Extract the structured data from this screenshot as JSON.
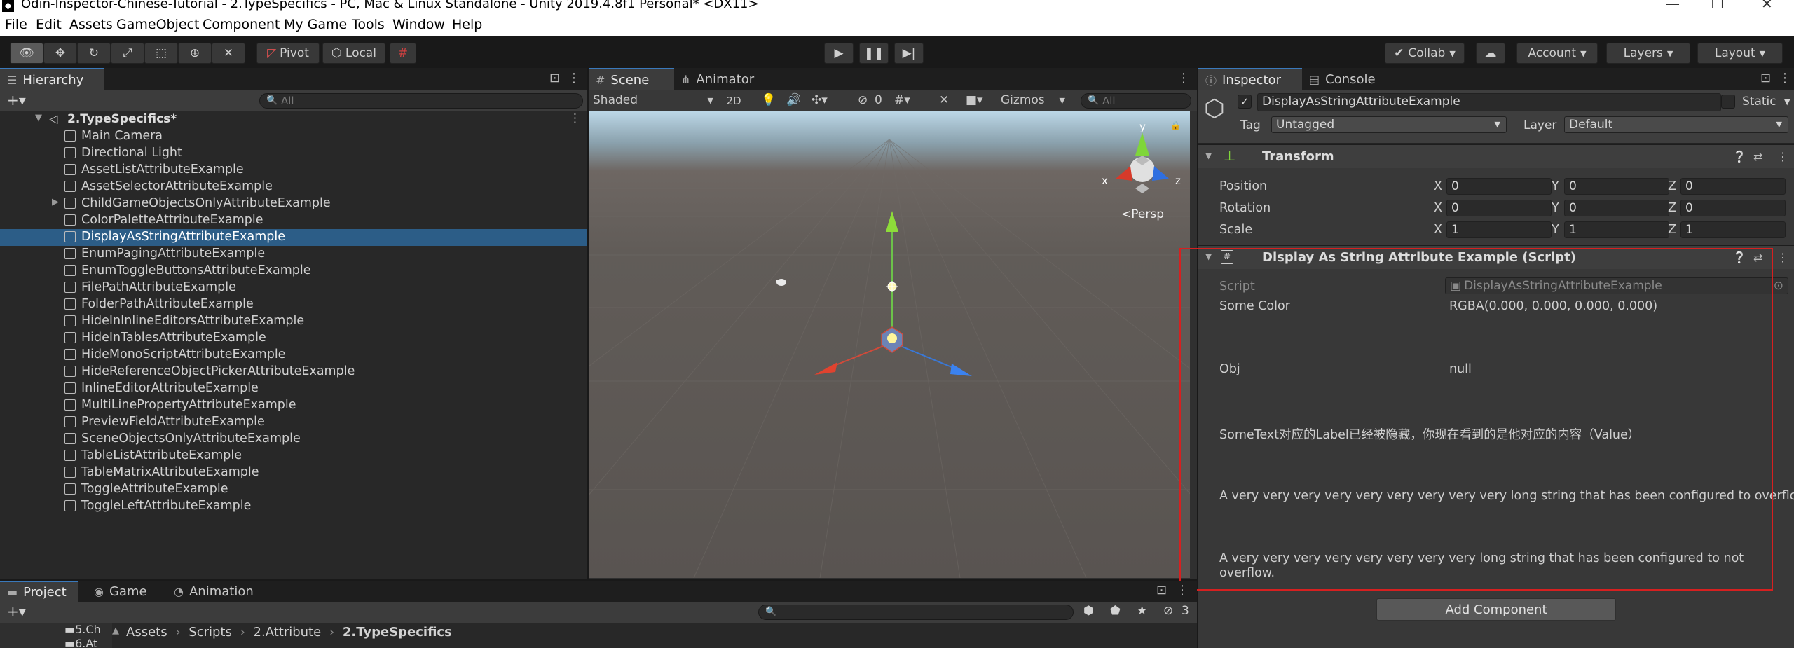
{
  "window": {
    "title": "Odin-Inspector-Chinese-Tutorial - 2.TypeSpecifics - PC, Mac & Linux Standalone - Unity 2019.4.8f1 Personal* <DX11>",
    "app_icon": "unity-icon"
  },
  "menu": [
    "File",
    "Edit",
    "Assets",
    "GameObject",
    "Component",
    "My Game",
    "Tools",
    "Window",
    "Help"
  ],
  "toolbar": {
    "pivot": "Pivot",
    "local": "Local",
    "collab": "Collab",
    "account": "Account",
    "layers": "Layers",
    "layout": "Layout"
  },
  "hierarchy": {
    "tab": "Hierarchy",
    "search_placeholder": "All",
    "scene": "2.TypeSpecifics*",
    "items": [
      "Main Camera",
      "Directional Light",
      "AssetListAttributeExample",
      "AssetSelectorAttributeExample",
      "ChildGameObjectsOnlyAttributeExample",
      "ColorPaletteAttributeExample",
      "DisplayAsStringAttributeExample",
      "EnumPagingAttributeExample",
      "EnumToggleButtonsAttributeExample",
      "FilePathAttributeExample",
      "FolderPathAttributeExample",
      "HideInInlineEditorsAttributeExample",
      "HideInTablesAttributeExample",
      "HideMonoScriptAttributeExample",
      "HideReferenceObjectPickerAttributeExample",
      "InlineEditorAttributeExample",
      "MultiLinePropertyAttributeExample",
      "PreviewFieldAttributeExample",
      "SceneObjectsOnlyAttributeExample",
      "TableListAttributeExample",
      "TableMatrixAttributeExample",
      "ToggleAttributeExample",
      "ToggleLeftAttributeExample"
    ],
    "selected_index": 6
  },
  "scene": {
    "tabs": [
      "Scene",
      "Animator"
    ],
    "shading": "Shaded",
    "mode_2d": "2D",
    "hidden_count": "0",
    "gizmos": "Gizmos",
    "search_placeholder": "All",
    "persp": "Persp",
    "axis_x": "x",
    "axis_y": "y",
    "axis_z": "z"
  },
  "inspector": {
    "tabs": [
      "Inspector",
      "Console"
    ],
    "object_name": "DisplayAsStringAttributeExample",
    "static_label": "Static",
    "tag_label": "Tag",
    "tag_value": "Untagged",
    "layer_label": "Layer",
    "layer_value": "Default",
    "transform": {
      "title": "Transform",
      "position_label": "Position",
      "rotation_label": "Rotation",
      "scale_label": "Scale",
      "x": "X",
      "y": "Y",
      "z": "Z",
      "position": [
        "0",
        "0",
        "0"
      ],
      "rotation": [
        "0",
        "0",
        "0"
      ],
      "scale": [
        "1",
        "1",
        "1"
      ]
    },
    "script_component": {
      "title": "Display As String Attribute Example (Script)",
      "script_label": "Script",
      "script_value": "DisplayAsStringAttributeExample",
      "some_color_label": "Some Color",
      "some_color_value": "RGBA(0.000, 0.000, 0.000, 0.000)",
      "obj_label": "Obj",
      "obj_value": "null",
      "some_text": "SomeText对应的Label已经被隐藏，你现在看到的是他对应的内容（Value）",
      "overflow_text": "A very very very very very very very very very long string that has been configured to overflow.",
      "no_overflow_text": "A very very very very very very very very long string that has been configured to not overflow."
    },
    "add_component": "Add Component"
  },
  "project": {
    "tabs": [
      "Project",
      "Game",
      "Animation"
    ],
    "folders": [
      "5.Ch",
      "6.At"
    ],
    "breadcrumb": [
      "Assets",
      "Scripts",
      "2.Attribute",
      "2.TypeSpecifics"
    ],
    "hidden_count": "3"
  }
}
